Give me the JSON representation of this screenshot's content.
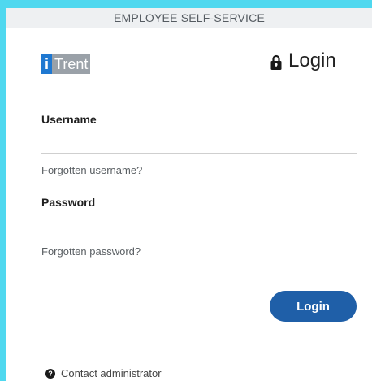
{
  "header": {
    "title": "EMPLOYEE SELF-SERVICE"
  },
  "brand": {
    "logo_i": "i",
    "logo_text": "Trent",
    "logo_i_color": "#1f78d1",
    "logo_bg_color": "#9aa1a8"
  },
  "login_heading": {
    "icon": "lock-icon",
    "text": "Login"
  },
  "form": {
    "username_label": "Username",
    "username_value": "",
    "forgot_username": "Forgotten username?",
    "password_label": "Password",
    "password_value": "",
    "forgot_password": "Forgotten password?",
    "submit_label": "Login",
    "submit_color": "#1f5fa8"
  },
  "footer": {
    "contact_icon": "help-circle-icon",
    "contact_text": "Contact administrator"
  },
  "colors": {
    "page_background": "#4fd8ef",
    "panel_background": "#ffffff",
    "header_background": "#eef0f2"
  }
}
